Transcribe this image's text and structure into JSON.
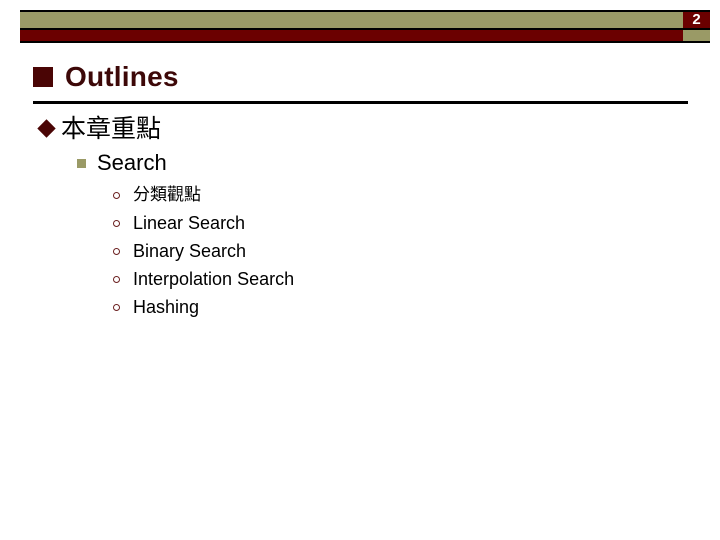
{
  "slide": {
    "page_number": "2",
    "title": "Outlines",
    "colors": {
      "banner_olive": "#9a9a66",
      "banner_red": "#6b0000",
      "title_maroon": "#3d0808",
      "bullet_maroon": "#4a0505",
      "bullet_olive": "#9a9a66",
      "rule_black": "#000000",
      "background": "#ffffff"
    },
    "header": {
      "olive_bar_name": "olive-banner-bar",
      "red_bar_name": "red-banner-bar"
    },
    "outline": {
      "level1": {
        "bullet": "diamond-bullet",
        "label": "本章重點"
      },
      "level2": {
        "bullet": "square-bullet",
        "label": "Search"
      },
      "level3": [
        {
          "bullet": "circle-bullet",
          "label": "分類觀點",
          "cjk": true
        },
        {
          "bullet": "circle-bullet",
          "label": "Linear Search",
          "cjk": false
        },
        {
          "bullet": "circle-bullet",
          "label": "Binary Search",
          "cjk": false
        },
        {
          "bullet": "circle-bullet",
          "label": "Interpolation Search",
          "cjk": false
        },
        {
          "bullet": "circle-bullet",
          "label": "Hashing",
          "cjk": false
        }
      ]
    }
  }
}
